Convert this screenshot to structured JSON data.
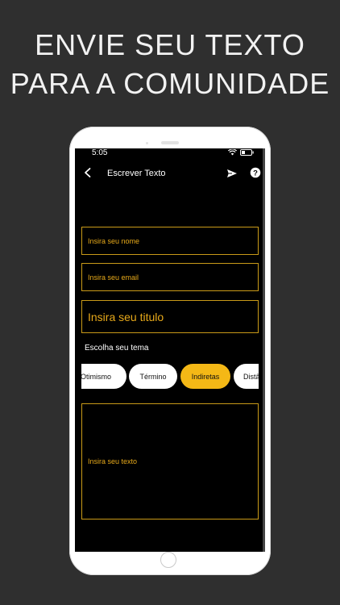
{
  "headline": {
    "line1": "ENVIE SEU TEXTO",
    "line2": "PARA A COMUNIDADE"
  },
  "status_bar": {
    "time": "5:05"
  },
  "nav": {
    "title": "Escrever Texto",
    "back_icon": "chevron-left-icon",
    "send_icon": "send-icon",
    "help_icon": "help-icon"
  },
  "form": {
    "name_placeholder": "Insira seu nome",
    "email_placeholder": "Insira seu email",
    "title_placeholder": "Insira seu titulo",
    "theme_label": "Escolha seu tema",
    "themes": [
      {
        "label": "Otimismo",
        "selected": false
      },
      {
        "label": "Término",
        "selected": false
      },
      {
        "label": "Indiretas",
        "selected": true
      },
      {
        "label": "Distâ",
        "selected": false
      }
    ],
    "text_placeholder": "Insira seu texto"
  },
  "colors": {
    "background": "#2f2f2f",
    "screen": "#000000",
    "accent": "#f4b816",
    "field_border": "#c99a18",
    "placeholder": "#e7a91a"
  }
}
